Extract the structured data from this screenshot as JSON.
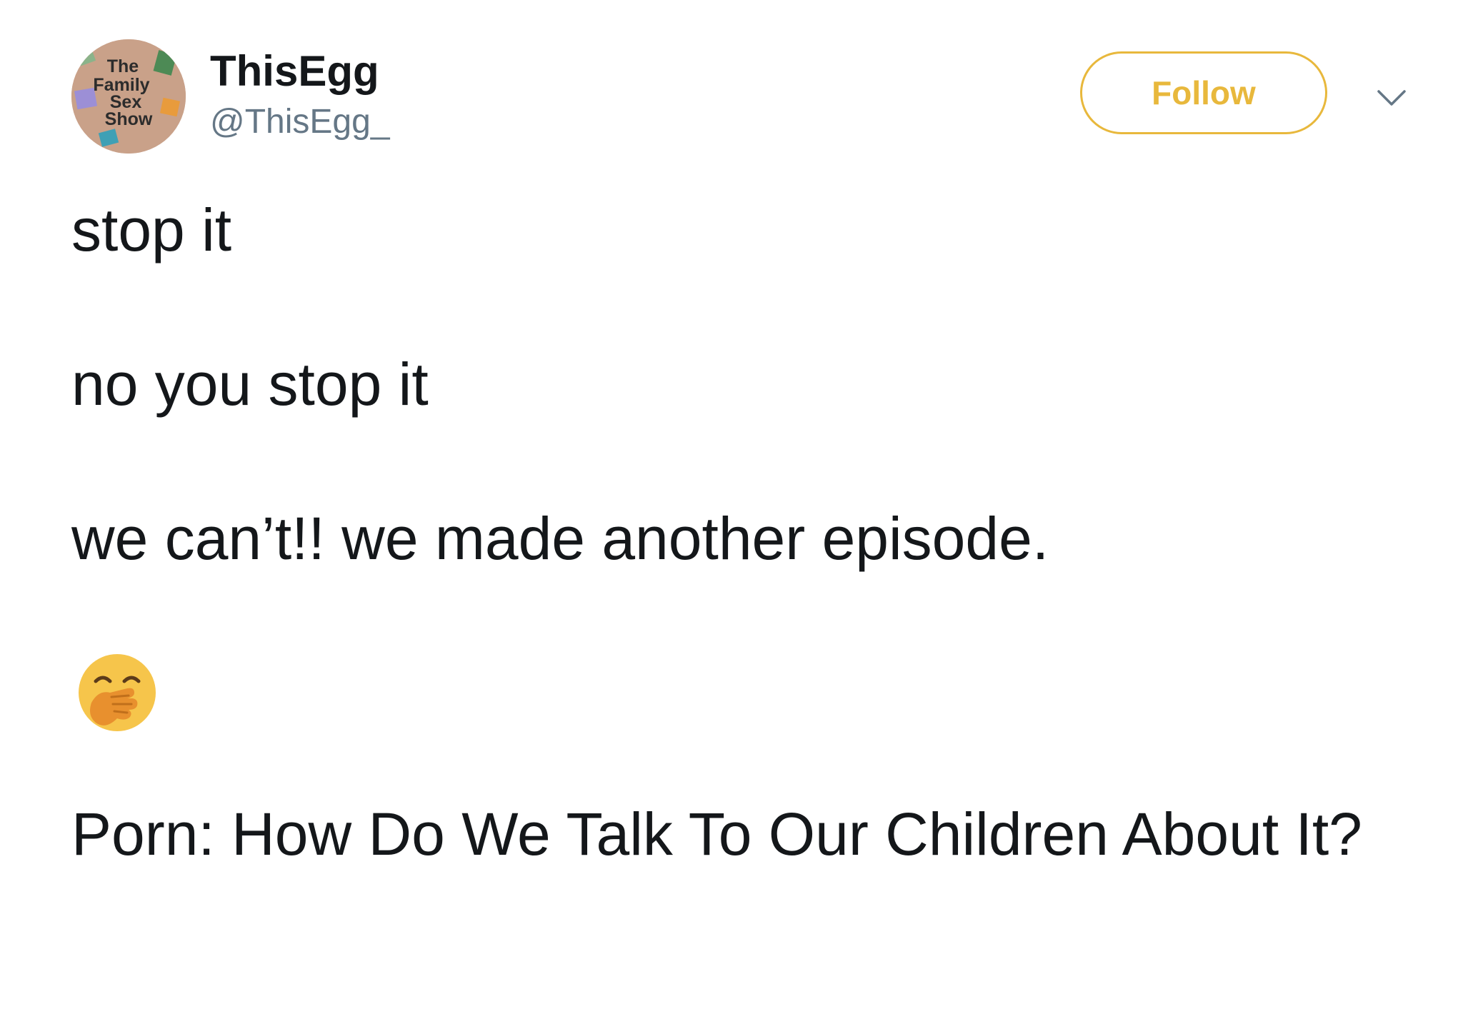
{
  "author": {
    "display_name": "ThisEgg",
    "handle": "@ThisEgg_",
    "avatar_text": [
      "The",
      "Family",
      "Sex",
      "Show"
    ]
  },
  "actions": {
    "follow_label": "Follow",
    "more_icon": "chevron-down-icon"
  },
  "tweet": {
    "lines": [
      "stop it",
      "no you stop it",
      "we can’t!! we made another episode."
    ],
    "emoji": "face-with-hand-over-mouth",
    "title": "Porn: How Do We Talk To Our Children About It?"
  },
  "colors": {
    "accent": "#e8b83c",
    "text": "#14171a",
    "secondary_text": "#657786",
    "avatar_bg": "#c9a189"
  }
}
